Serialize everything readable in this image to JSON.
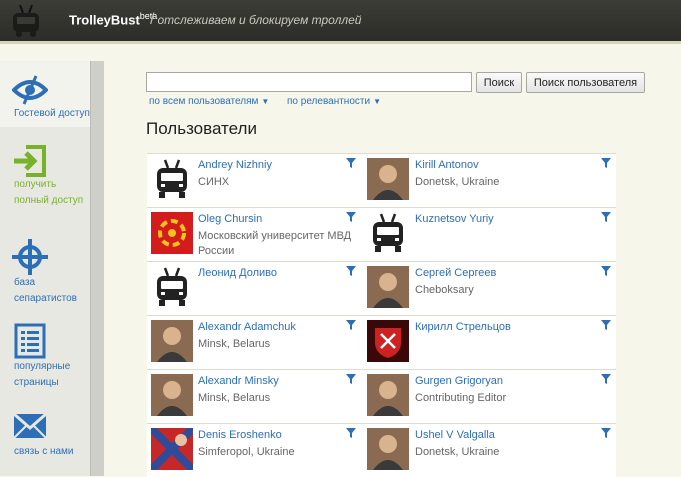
{
  "header": {
    "brand": "TrolleyBust",
    "brand_sup": "beta",
    "slash": "/",
    "slogan": "отслеживаем и блокируем троллей",
    "bg_color": "#333330"
  },
  "sidebar": {
    "items": [
      {
        "label": "Гостевой доступ",
        "icon": "eye-icon",
        "color": "#2d6fb6"
      },
      {
        "label": "получить полный доступ",
        "icon": "login-arrow-icon",
        "color": "#77b22b"
      },
      {
        "label": "база сепаратистов",
        "icon": "crosshair-icon",
        "color": "#2d6fb6"
      },
      {
        "label": "популярные страницы",
        "icon": "list-icon",
        "color": "#2d6fb6"
      },
      {
        "label": "связь с нами",
        "icon": "envelope-icon",
        "color": "#2d6fb6"
      }
    ]
  },
  "search": {
    "value": "",
    "placeholder": "",
    "button_label": "Поиск",
    "user_button_label": "Поиск пользователя"
  },
  "filters": {
    "scope": "по всем пользователям",
    "sort": "по релевантности"
  },
  "section_title": "Пользователи",
  "users": [
    {
      "name": "Andrey Nizhniy",
      "sub": "СИНХ",
      "avatar": "trolleybus-placeholder-icon"
    },
    {
      "name": "Kirill Antonov",
      "sub": "Donetsk, Ukraine",
      "avatar": "photo"
    },
    {
      "name": "Oleg Chursin",
      "sub": "Московский университет МВД России",
      "avatar": "red-kolovrat"
    },
    {
      "name": "Kuznetsov Yuriy",
      "sub": "",
      "avatar": "trolleybus-placeholder-icon"
    },
    {
      "name": "Леонид Доливо",
      "sub": "",
      "avatar": "trolleybus-placeholder-icon"
    },
    {
      "name": "Сергей Сергеев",
      "sub": "Cheboksary",
      "avatar": "photo"
    },
    {
      "name": "Alexandr Adamchuk",
      "sub": "Minsk, Belarus",
      "avatar": "photo"
    },
    {
      "name": "Кирилл Стрельцов",
      "sub": "",
      "avatar": "red-emblem"
    },
    {
      "name": "Alexandr Minsky",
      "sub": "Minsk, Belarus",
      "avatar": "photo"
    },
    {
      "name": "Gurgen Grigoryan",
      "sub": "Contributing Editor",
      "avatar": "photo"
    },
    {
      "name": "Denis Eroshenko",
      "sub": "Simferopol, Ukraine",
      "avatar": "flag-photo"
    },
    {
      "name": "Ushel V Valgalla",
      "sub": "Donetsk, Ukraine",
      "avatar": "photo"
    }
  ],
  "colors": {
    "link": "#2d6fb6",
    "green": "#77b22b",
    "page_bg": "#f6f6ea"
  }
}
